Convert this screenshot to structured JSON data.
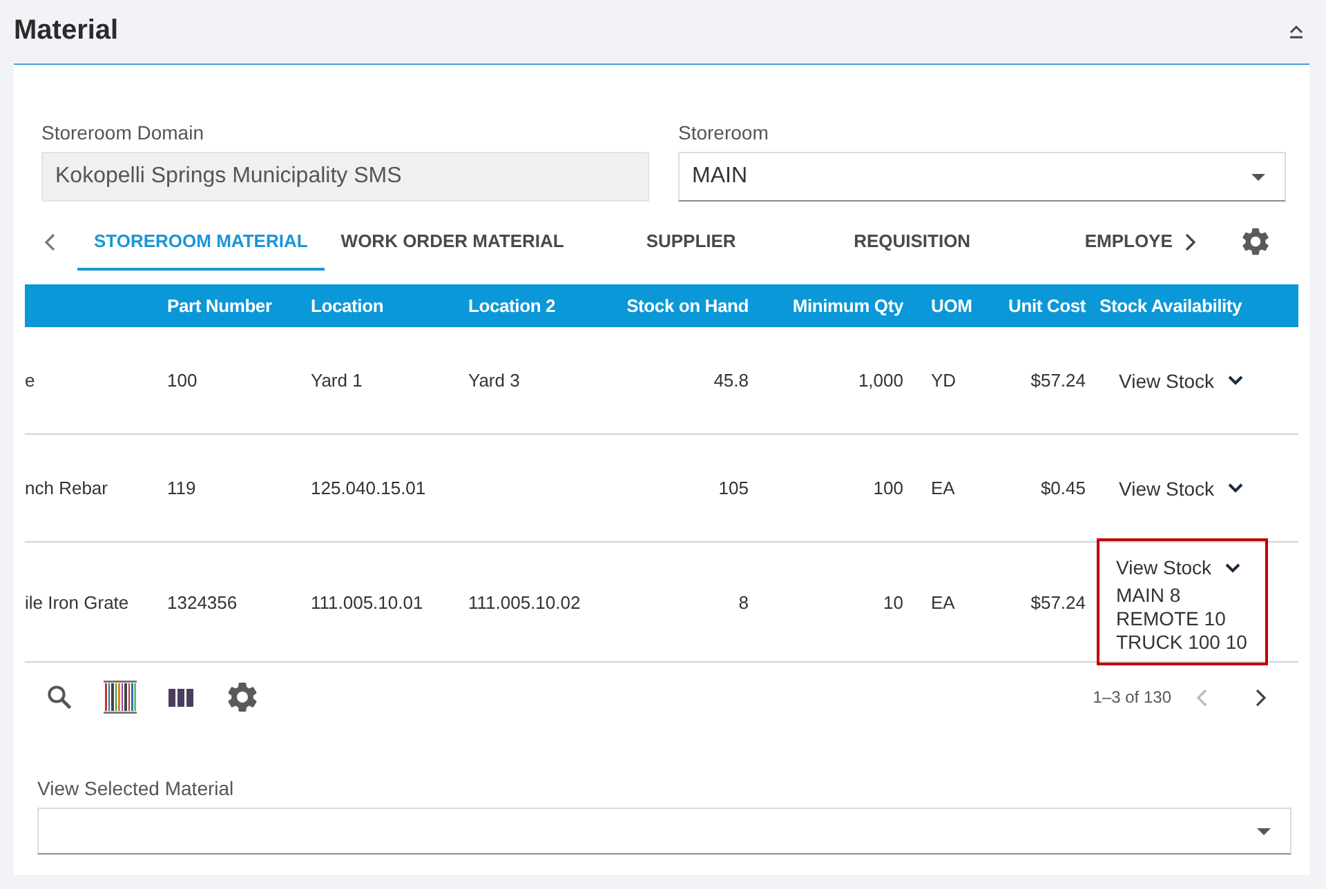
{
  "section": {
    "title": "Material"
  },
  "fields": [
    {
      "label": "Storeroom Domain",
      "value": "Kokopelli Springs Municipality SMS",
      "kind": "readonly"
    },
    {
      "label": "Storeroom",
      "value": "MAIN",
      "kind": "dropdown"
    }
  ],
  "tabs": [
    {
      "label": "STOREROOM MATERIAL",
      "selected": true
    },
    {
      "label": "WORK ORDER MATERIAL",
      "selected": false
    },
    {
      "label": "SUPPLIER",
      "selected": false
    },
    {
      "label": "REQUISITION",
      "selected": false
    },
    {
      "label": "EMPLOYE",
      "selected": false
    }
  ],
  "table": {
    "columns": [
      {
        "label": "Part Number",
        "kind": "text"
      },
      {
        "label": "Location",
        "kind": "text"
      },
      {
        "label": "Location 2",
        "kind": "text"
      },
      {
        "label": "Stock on Hand",
        "kind": "number"
      },
      {
        "label": "Minimum Qty",
        "kind": "number"
      },
      {
        "label": "UOM",
        "kind": "text"
      },
      {
        "label": "Unit Cost",
        "kind": "number"
      },
      {
        "label": "Stock Availability",
        "kind": "availability"
      }
    ],
    "rows": [
      {
        "column_1": "e",
        "cells": [
          "100",
          "Yard 1",
          "Yard 3",
          "45.8",
          "1,000",
          "YD",
          "$57.24"
        ],
        "stock": {
          "label": "View Stock"
        },
        "highlighted": false
      },
      {
        "column_1": "nch Rebar",
        "cells": [
          "119",
          "125.040.15.01",
          null,
          "105",
          "100",
          "EA",
          "$0.45"
        ],
        "stock": {
          "label": "View Stock"
        },
        "highlighted": false
      },
      {
        "column_1": "ile Iron Grate",
        "cells": [
          "1324356",
          "111.005.10.01",
          "111.005.10.02",
          "8",
          "10",
          "EA",
          "$57.24"
        ],
        "stock": {
          "label": "View Stock",
          "locations": [
            "MAIN 8",
            "REMOTE 10",
            "TRUCK 100 10"
          ]
        },
        "highlighted": true
      }
    ]
  },
  "pagination": {
    "range": "1–3 of 130",
    "previous_disabled": true,
    "next_disabled": false
  },
  "selected_material": {
    "label": "View Selected Material",
    "kind": "dropdown"
  }
}
